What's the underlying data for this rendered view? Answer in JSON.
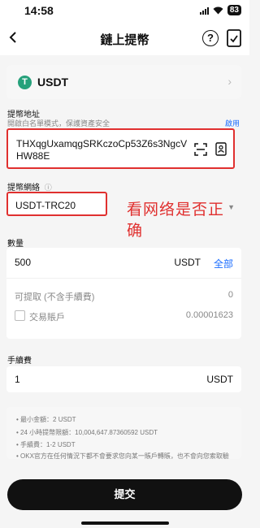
{
  "status_bar": {
    "time": "14:58",
    "battery": "83"
  },
  "header": {
    "title": "鏈上提幣",
    "help_icon": "?"
  },
  "coin": {
    "icon_letter": "T",
    "name": "USDT",
    "chevron": "›",
    "accent": "#26a17b"
  },
  "address": {
    "label": "提幣地址",
    "hint": "開啟白名單模式，保護資產安全",
    "enable_link": "啟用",
    "value": "THXqgUxamqgSRKczoCp53Z6s3NgcVHW88E"
  },
  "network": {
    "label": "提幣網絡",
    "info_icon": "ⓘ",
    "value": "USDT-TRC20",
    "dropdown_icon": "▼"
  },
  "annotation": {
    "text": "看网络是否正确",
    "color": "#e0302f"
  },
  "amount": {
    "label": "數量",
    "value": "500",
    "unit": "USDT",
    "all_button": "全部",
    "available_label": "可提取 (不含手續費)",
    "available_value": "0",
    "trading_account_label": "交易賬戶",
    "trading_account_value": "0.00001623"
  },
  "fee": {
    "label": "手續費",
    "value": "1",
    "unit": "USDT"
  },
  "info": {
    "lines": [
      "最小金額：2 USDT",
      "24 小時提幣限額：10,004,647.87360592 USDT",
      "手續費：1-2 USDT",
      "OKX官方在任何情況下都不會要求您向某一賬戶轉賬，也不會向您索取驗證碼。"
    ]
  },
  "submit": {
    "label": "提交"
  },
  "colors": {
    "link": "#1a6cff",
    "highlight_border": "#e0302f",
    "button": "#111111"
  }
}
